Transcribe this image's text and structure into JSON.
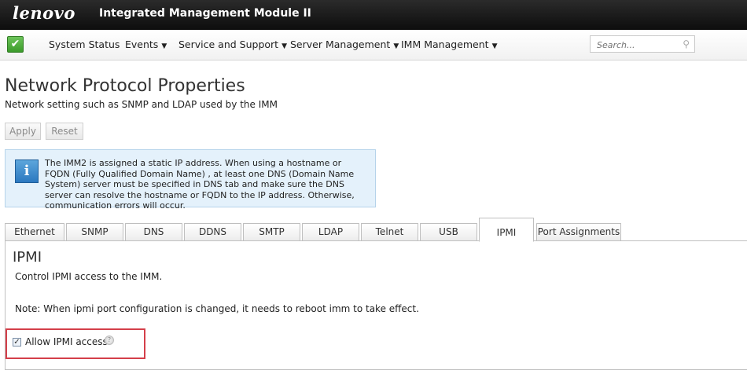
{
  "header": {
    "brand": "lenovo",
    "product": "Integrated Management Module II"
  },
  "nav": {
    "status_icon": "check-icon",
    "menus": [
      {
        "label": "System Status",
        "dropdown": false
      },
      {
        "label": "Events",
        "dropdown": true
      },
      {
        "label": "Service and Support",
        "dropdown": true
      },
      {
        "label": "Server Management",
        "dropdown": true
      },
      {
        "label": "IMM Management",
        "dropdown": true
      }
    ],
    "search": {
      "placeholder": "Search...",
      "value": ""
    }
  },
  "page": {
    "title": "Network Protocol Properties",
    "subtitle": "Network setting such as SNMP and LDAP used by the IMM"
  },
  "actions": {
    "apply_label": "Apply",
    "reset_label": "Reset"
  },
  "info": {
    "text": "The IMM2 is assigned a static IP address. When using a hostname or FQDN (Fully Qualified Domain Name) , at least one DNS (Domain Name System) server must be specified in DNS tab and make sure the DNS server can resolve the hostname or FQDN to the IP address. Otherwise, communication errors will occur."
  },
  "tabs": [
    {
      "label": "Ethernet",
      "active": false
    },
    {
      "label": "SNMP",
      "active": false
    },
    {
      "label": "DNS",
      "active": false
    },
    {
      "label": "DDNS",
      "active": false
    },
    {
      "label": "SMTP",
      "active": false
    },
    {
      "label": "LDAP",
      "active": false
    },
    {
      "label": "Telnet",
      "active": false
    },
    {
      "label": "USB",
      "active": false
    },
    {
      "label": "IPMI",
      "active": true
    },
    {
      "label": "Port Assignments",
      "active": false
    }
  ],
  "ipmi": {
    "title": "IPMI",
    "description": "Control IPMI access to the IMM.",
    "note": "Note: When ipmi port configuration is changed, it needs to reboot imm to take effect.",
    "allow_access": {
      "label": "Allow IPMI access",
      "checked": true
    }
  },
  "colors": {
    "highlight": "#d43f4a",
    "info_bg": "#e4f1fb",
    "topbar": "#111111"
  }
}
